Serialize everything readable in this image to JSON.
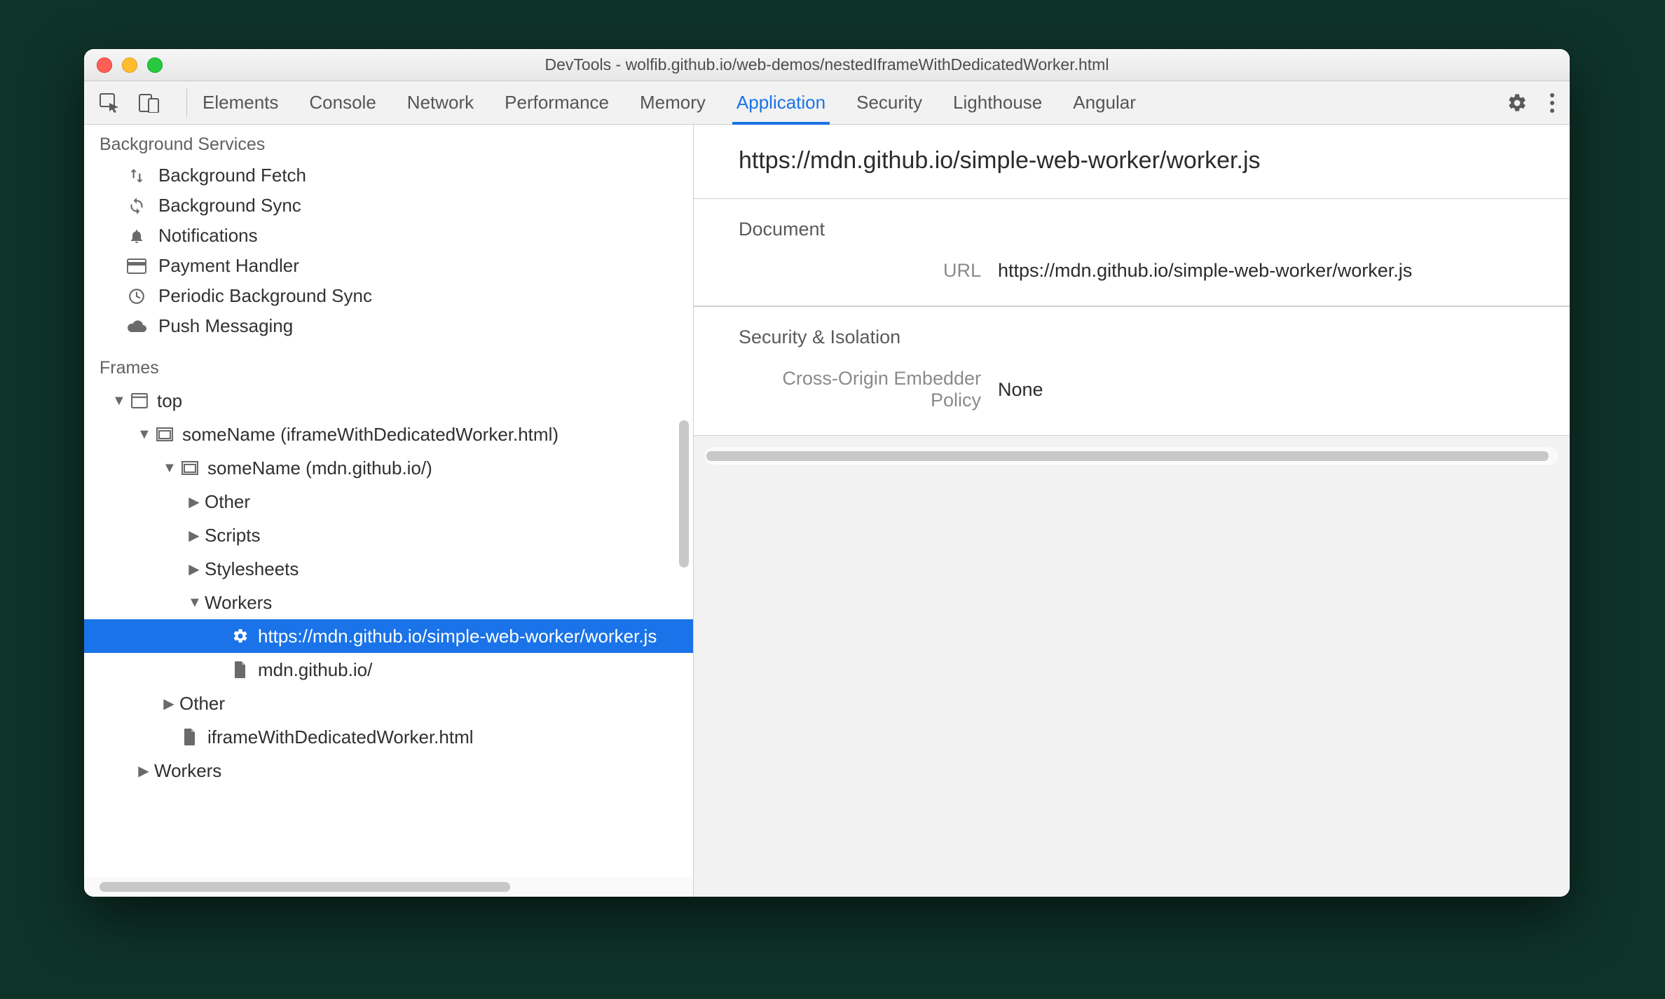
{
  "titlebar": {
    "title": "DevTools - wolfib.github.io/web-demos/nestedIframeWithDedicatedWorker.html"
  },
  "tabs": [
    {
      "label": "Elements",
      "name": "tab-elements",
      "active": false
    },
    {
      "label": "Console",
      "name": "tab-console",
      "active": false
    },
    {
      "label": "Network",
      "name": "tab-network",
      "active": false
    },
    {
      "label": "Performance",
      "name": "tab-performance",
      "active": false
    },
    {
      "label": "Memory",
      "name": "tab-memory",
      "active": false
    },
    {
      "label": "Application",
      "name": "tab-application",
      "active": true
    },
    {
      "label": "Security",
      "name": "tab-security",
      "active": false
    },
    {
      "label": "Lighthouse",
      "name": "tab-lighthouse",
      "active": false
    },
    {
      "label": "Angular",
      "name": "tab-angular",
      "active": false
    }
  ],
  "sidebar": {
    "background_services_title": "Background Services",
    "services": [
      {
        "icon": "arrows-updown-icon",
        "label": "Background Fetch",
        "name": "svc-background-fetch"
      },
      {
        "icon": "sync-icon",
        "label": "Background Sync",
        "name": "svc-background-sync"
      },
      {
        "icon": "bell-icon",
        "label": "Notifications",
        "name": "svc-notifications"
      },
      {
        "icon": "card-icon",
        "label": "Payment Handler",
        "name": "svc-payment-handler"
      },
      {
        "icon": "clock-icon",
        "label": "Periodic Background Sync",
        "name": "svc-periodic-background-sync"
      },
      {
        "icon": "cloud-icon",
        "label": "Push Messaging",
        "name": "svc-push-messaging"
      }
    ],
    "frames_title": "Frames",
    "tree": [
      {
        "depth": 0,
        "arrow": "exp",
        "icon": "window-icon",
        "label": "top",
        "name": "frame-top"
      },
      {
        "depth": 1,
        "arrow": "exp",
        "icon": "iframe-icon",
        "label": "someName (iframeWithDedicatedWorker.html)",
        "name": "frame-somename-1"
      },
      {
        "depth": 2,
        "arrow": "exp",
        "icon": "iframe-icon",
        "label": "someName (mdn.github.io/)",
        "name": "frame-somename-2"
      },
      {
        "depth": 3,
        "arrow": "col",
        "icon": "",
        "label": "Other",
        "name": "frame-other-1"
      },
      {
        "depth": 3,
        "arrow": "col",
        "icon": "",
        "label": "Scripts",
        "name": "frame-scripts"
      },
      {
        "depth": 3,
        "arrow": "col",
        "icon": "",
        "label": "Stylesheets",
        "name": "frame-stylesheets"
      },
      {
        "depth": 3,
        "arrow": "exp",
        "icon": "",
        "label": "Workers",
        "name": "frame-workers-1"
      },
      {
        "depth": 4,
        "arrow": "none",
        "icon": "gear-icon",
        "label": "https://mdn.github.io/simple-web-worker/worker.js",
        "name": "frame-worker-js",
        "selected": true
      },
      {
        "depth": 4,
        "arrow": "none",
        "icon": "file-icon",
        "label": "mdn.github.io/",
        "name": "frame-mdn-file"
      },
      {
        "depth": 2,
        "arrow": "col",
        "icon": "",
        "label": "Other",
        "name": "frame-other-2"
      },
      {
        "depth": 2,
        "arrow": "none",
        "icon": "file-icon",
        "label": "iframeWithDedicatedWorker.html",
        "name": "frame-iframe-file"
      },
      {
        "depth": 1,
        "arrow": "col",
        "icon": "",
        "label": "Workers",
        "name": "frame-workers-2"
      }
    ]
  },
  "main": {
    "title": "https://mdn.github.io/simple-web-worker/worker.js",
    "sections": [
      {
        "title": "Document",
        "name": "section-document",
        "rows": [
          {
            "k": "URL",
            "v": "https://mdn.github.io/simple-web-worker/worker.js",
            "name": "row-url"
          }
        ]
      },
      {
        "title": "Security & Isolation",
        "name": "section-security-isolation",
        "rows": [
          {
            "k": "Cross-Origin Embedder Policy",
            "v": "None",
            "name": "row-coep"
          }
        ]
      }
    ]
  }
}
